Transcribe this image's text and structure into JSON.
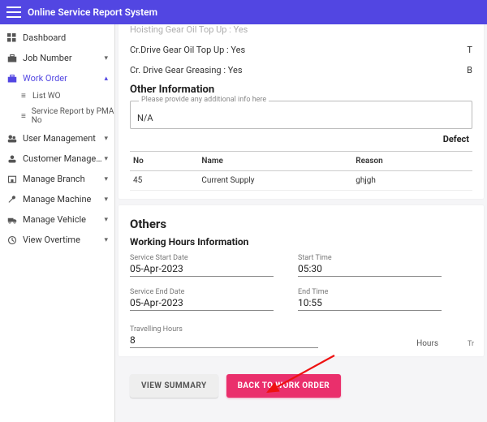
{
  "header": {
    "title": "Online Service Report System"
  },
  "sidebar": {
    "items": [
      {
        "label": "Dashboard"
      },
      {
        "label": "Job Number"
      },
      {
        "label": "Work Order"
      },
      {
        "label": "User Management"
      },
      {
        "label": "Customer Management"
      },
      {
        "label": "Manage Branch"
      },
      {
        "label": "Manage Machine"
      },
      {
        "label": "Manage Vehicle"
      },
      {
        "label": "View Overtime"
      }
    ],
    "wo_sub": [
      {
        "label": "List WO"
      },
      {
        "label": "Service Report by PMA No"
      }
    ]
  },
  "details": {
    "hoisting": {
      "label": "Hoisting Gear Oil Top Up :",
      "value": "Yes"
    },
    "crdrive": {
      "label": "Cr.Drive Gear Oil Top Up :",
      "value": "Yes",
      "right": "T"
    },
    "crdrive_g": {
      "label": "Cr. Drive Gear Greasing :",
      "value": "Yes",
      "right": "B"
    },
    "other_info_header": "Other Information",
    "other_info_legend": "Please provide any additional info here",
    "other_info_value": "N/A",
    "defects_title": "Defect",
    "defects_cols": {
      "no": "No",
      "name": "Name",
      "reason": "Reason"
    },
    "defects_rows": [
      {
        "no": "45",
        "name": "Current Supply",
        "reason": "ghjgh"
      }
    ]
  },
  "others": {
    "title": "Others",
    "working_hours_header": "Working Hours Information",
    "start_date_label": "Service Start Date",
    "start_date_value": "05-Apr-2023",
    "start_time_label": "Start Time",
    "start_time_value": "05:30",
    "end_date_label": "Service End Date",
    "end_date_value": "05-Apr-2023",
    "end_time_label": "End Time",
    "end_time_value": "10:55",
    "travel_label": "Travelling Hours",
    "travel_value": "8",
    "hours_unit": "Hours",
    "tr_col": "Tr"
  },
  "buttons": {
    "view_summary": "VIEW SUMMARY",
    "back": "BACK TO WORK ORDER"
  }
}
